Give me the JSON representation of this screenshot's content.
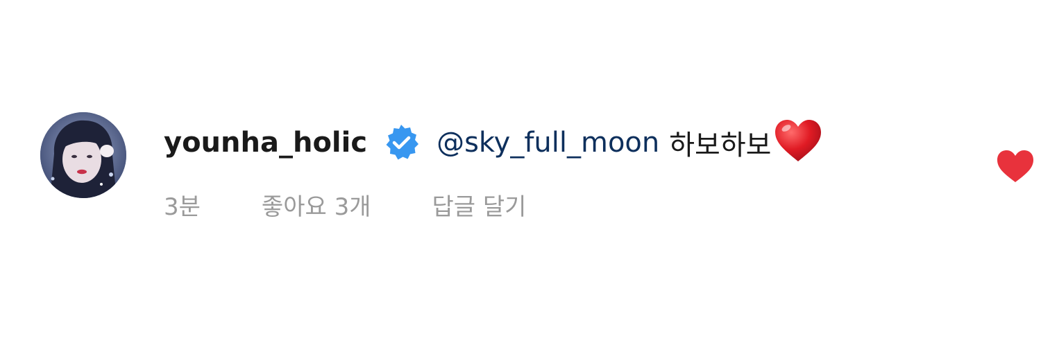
{
  "comment": {
    "username": "younha_holic",
    "verified_icon": "verified-badge-icon",
    "mention": "@sky_full_moon",
    "text": "하보하보",
    "emoji": "red-heart-emoji",
    "time": "3분",
    "likes": "좋아요 3개",
    "reply": "답글 달기"
  },
  "like_button": {
    "icon": "heart-icon",
    "state": "liked",
    "color": "#e8323c"
  },
  "colors": {
    "verified_blue": "#3897f0",
    "mention": "#0d2f5c",
    "meta_gray": "#9a9a9a"
  }
}
